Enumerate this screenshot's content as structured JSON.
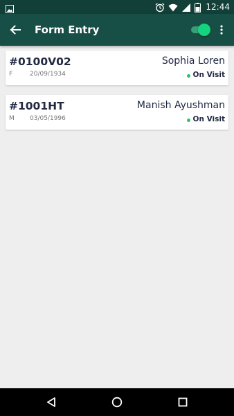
{
  "status_bar": {
    "time": "12:44",
    "icons": [
      "image-icon",
      "alarm-icon",
      "wifi-icon",
      "signal-icon",
      "battery-icon"
    ]
  },
  "app_bar": {
    "title": "Form Entry",
    "toggle_on": true,
    "accent_color": "#14d57e",
    "background_color": "#174e45"
  },
  "records": [
    {
      "id": "#0100V02",
      "gender": "F",
      "dob": "20/09/1934",
      "name": "Sophia Loren",
      "status": "On Visit",
      "status_color": "#2fbf6a"
    },
    {
      "id": "#1001HT",
      "gender": "M",
      "dob": "03/05/1996",
      "name": "Manish Ayushman",
      "status": "On Visit",
      "status_color": "#2fbf6a"
    }
  ],
  "nav_bar": {
    "icons": [
      "back-triangle-icon",
      "home-circle-icon",
      "recents-square-icon"
    ]
  }
}
